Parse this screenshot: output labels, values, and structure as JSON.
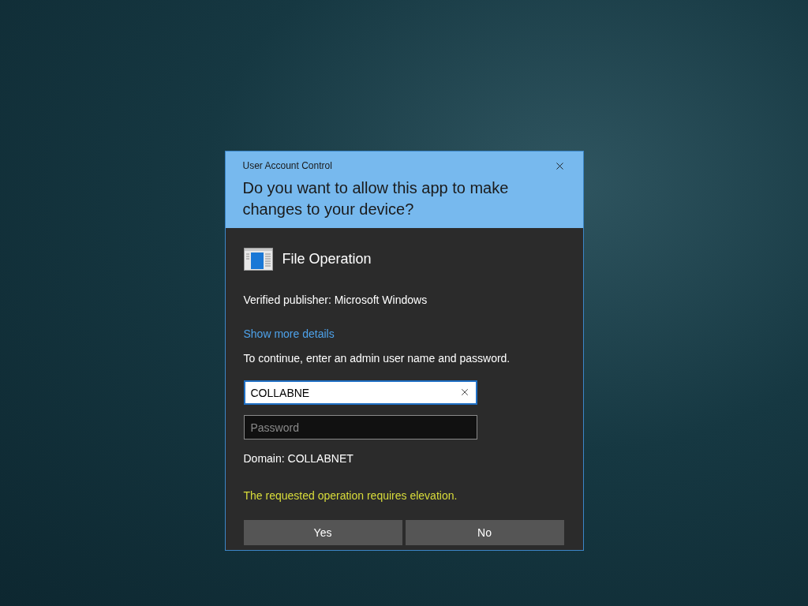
{
  "dialog": {
    "title": "User Account Control",
    "question": "Do you want to allow this app to make changes to your device?",
    "app_name": "File Operation",
    "publisher": "Verified publisher: Microsoft Windows",
    "details_link": "Show more details",
    "instruction": "To continue, enter an admin user name and password.",
    "fields": [
      {
        "kind": "text",
        "value": "COLLABNE",
        "focused": true
      },
      {
        "kind": "password",
        "placeholder": "Password",
        "focused": false
      }
    ],
    "domain": "Domain: COLLABNET",
    "error": "The requested operation requires elevation.",
    "buttons": [
      "Yes",
      "No"
    ]
  }
}
